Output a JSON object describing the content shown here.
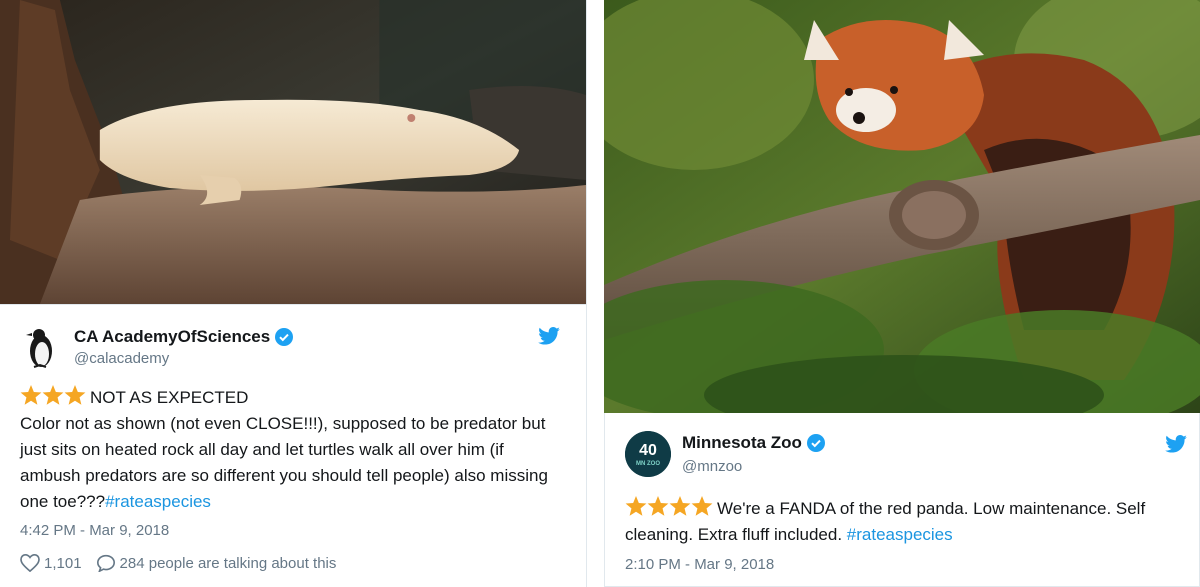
{
  "left_tweet": {
    "display_name": "CA AcademyOfSciences",
    "handle": "@calacademy",
    "rating_title": "NOT AS EXPECTED",
    "rating_stars": 3,
    "body": "Color not as shown (not even CLOSE!!!), supposed to be predator but just sits on heated rock all day and let turtles walk all over him (if ambush predators are so different you should tell people) also missing one toe???",
    "hashtag": "#rateaspecies",
    "timestamp": "4:42 PM - Mar 9, 2018",
    "likes": "1,101",
    "replies_text": "284 people are talking about this",
    "avatar_icon": "penguin-icon",
    "photo_subject": "albino-alligator-image"
  },
  "right_tweet": {
    "display_name": "Minnesota Zoo",
    "handle": "@mnzoo",
    "avatar_text_top": "40",
    "avatar_text_bottom": "MN ZOO",
    "rating_stars": 4,
    "body": "We're a FANDA of the red panda. Low maintenance. Self cleaning. Extra fluff included.",
    "hashtag": "#rateaspecies",
    "timestamp": "2:10 PM - Mar 9, 2018",
    "photo_subject": "red-panda-image"
  },
  "colors": {
    "star": "#f5a623",
    "link": "#1b95e0",
    "verified": "#1da1f2",
    "muted": "#657786"
  }
}
